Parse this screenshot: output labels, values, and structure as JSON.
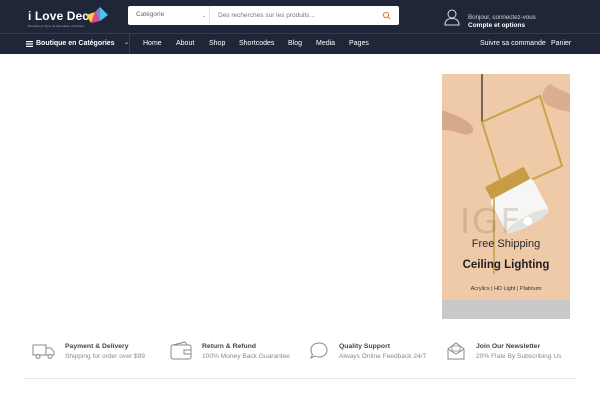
{
  "header": {
    "logo_text": "i Love Deco",
    "logo_tagline": "Boutique en ligne de décoration d'intérieur",
    "search": {
      "category_label": "Catégorie",
      "placeholder": "Des recherches sur les produits..."
    },
    "account": {
      "greeting": "Bonjour, connectez-vous",
      "link": "Compte et options"
    },
    "colors": {
      "bar": "#1f2638",
      "accent": "#f07c2b"
    }
  },
  "nav": {
    "categories_label": "Boutique en Catégories",
    "items": [
      "Home",
      "About",
      "Shop",
      "Shortcodes",
      "Blog",
      "Media",
      "Pages"
    ],
    "track_order": "Suivre sa commande",
    "cart": "Panier"
  },
  "banner": {
    "watermark": "IGF",
    "title": "Free Shipping",
    "subtitle": "Ceiling Lighting",
    "tags": "Acrylics | HD Light | Platinum"
  },
  "features": [
    {
      "icon": "truck-icon",
      "title": "Payment & Delivery",
      "subtitle": "Shipping for order over $99"
    },
    {
      "icon": "wallet-icon",
      "title": "Return & Refund",
      "subtitle": "100% Money Back Guarantee"
    },
    {
      "icon": "chat-bubble-icon",
      "title": "Quality Support",
      "subtitle": "Always Online Feedback 24/7"
    },
    {
      "icon": "envelope-icon",
      "title": "Join Our Newsletter",
      "subtitle": "20% Flate By Subscribing Us"
    }
  ]
}
